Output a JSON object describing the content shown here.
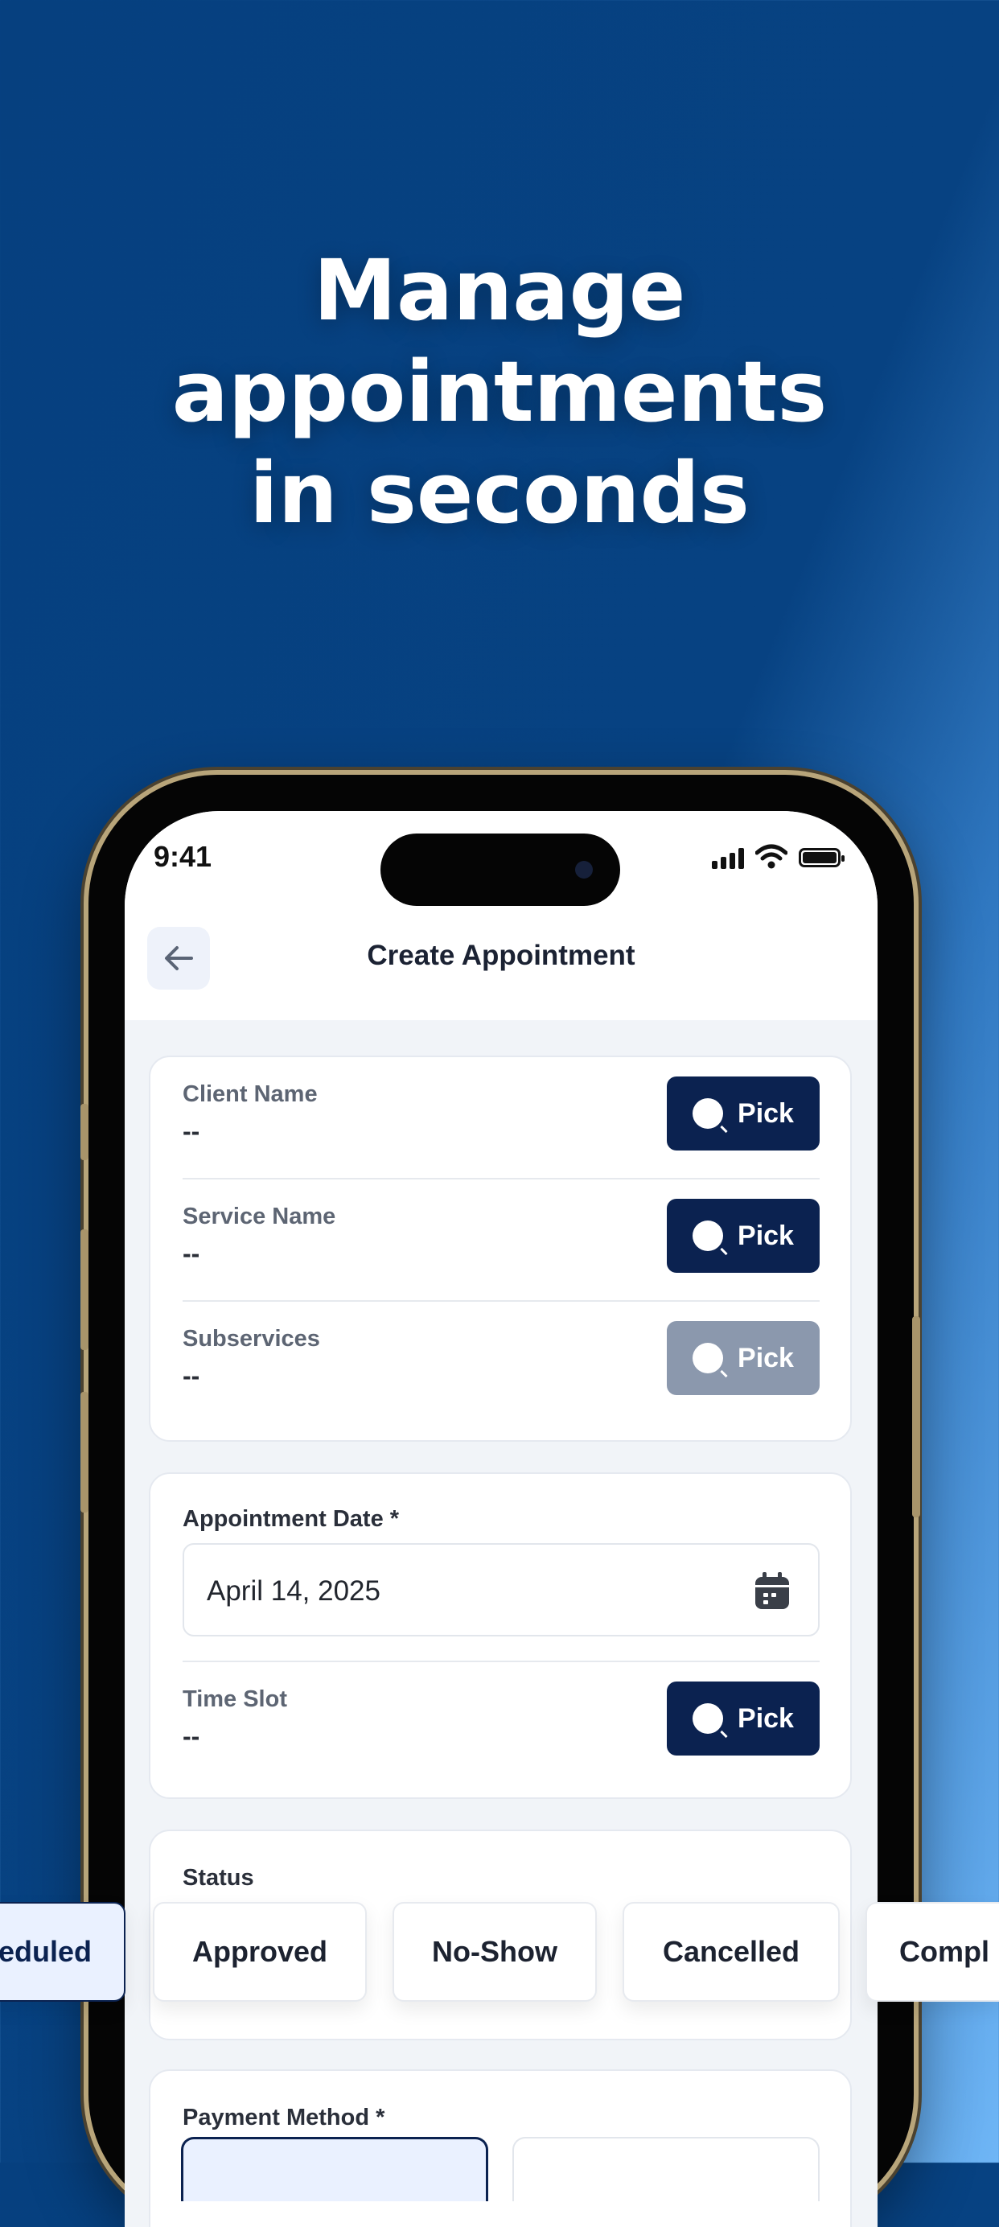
{
  "headline": [
    "Manage",
    "appointments",
    "in seconds"
  ],
  "status_bar": {
    "time": "9:41"
  },
  "nav": {
    "title": "Create Appointment"
  },
  "client": {
    "label": "Client Name",
    "value": "--",
    "button": "Pick"
  },
  "service": {
    "label": "Service Name",
    "value": "--",
    "button": "Pick"
  },
  "subservices": {
    "label": "Subservices",
    "value": "--",
    "button": "Pick"
  },
  "date": {
    "label": "Appointment Date *",
    "value": "April 14, 2025"
  },
  "time_slot": {
    "label": "Time Slot",
    "value": "--",
    "button": "Pick"
  },
  "status": {
    "label": "Status",
    "options": [
      "eduled",
      "Approved",
      "No-Show",
      "Cancelled",
      "Compl"
    ],
    "selected": "eduled"
  },
  "payment": {
    "label": "Payment Method *"
  },
  "colors": {
    "primary": "#0b2250",
    "disabled": "#8b98ad",
    "bg_top": "#06407f",
    "bg_accent": "#6fb6f6"
  }
}
